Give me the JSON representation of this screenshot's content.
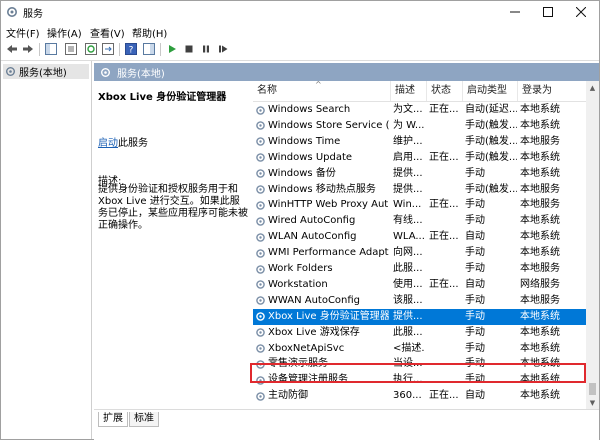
{
  "window": {
    "title": "服务"
  },
  "menu": [
    "文件(F)",
    "操作(A)",
    "查看(V)",
    "帮助(H)"
  ],
  "tree": {
    "root": "服务(本地)"
  },
  "panel": {
    "header": "服务(本地)"
  },
  "description": {
    "service_name": "Xbox Live 身份验证管理器",
    "start_link": "启动",
    "start_suffix": "此服务",
    "label": "描述:",
    "text": "提供身份验证和授权服务用于和 Xbox Live 进行交互。如果此服务已停止，某些应用程序可能未被正确操作。"
  },
  "columns": {
    "name": "名称",
    "desc": "描述",
    "status": "状态",
    "startup": "启动类型",
    "logon": "登录为"
  },
  "services": [
    {
      "name": "Windows Search",
      "desc": "为文...",
      "status": "正在...",
      "startup": "自动(延迟...",
      "logon": "本地系统"
    },
    {
      "name": "Windows Store Service (...",
      "desc": "为 W...",
      "status": "",
      "startup": "手动(触发...",
      "logon": "本地系统"
    },
    {
      "name": "Windows Time",
      "desc": "维护...",
      "status": "",
      "startup": "手动(触发...",
      "logon": "本地服务"
    },
    {
      "name": "Windows Update",
      "desc": "启用...",
      "status": "正在...",
      "startup": "手动(触发...",
      "logon": "本地系统"
    },
    {
      "name": "Windows 备份",
      "desc": "提供...",
      "status": "",
      "startup": "手动",
      "logon": "本地系统"
    },
    {
      "name": "Windows 移动热点服务",
      "desc": "提供...",
      "status": "",
      "startup": "手动(触发...",
      "logon": "本地服务"
    },
    {
      "name": "WinHTTP Web Proxy Aut...",
      "desc": "Win...",
      "status": "正在...",
      "startup": "手动",
      "logon": "本地服务"
    },
    {
      "name": "Wired AutoConfig",
      "desc": "有线...",
      "status": "",
      "startup": "手动",
      "logon": "本地系统"
    },
    {
      "name": "WLAN AutoConfig",
      "desc": "WLA...",
      "status": "正在...",
      "startup": "自动",
      "logon": "本地系统"
    },
    {
      "name": "WMI Performance Adapt...",
      "desc": "向网...",
      "status": "",
      "startup": "手动",
      "logon": "本地系统"
    },
    {
      "name": "Work Folders",
      "desc": "此服...",
      "status": "",
      "startup": "手动",
      "logon": "本地服务"
    },
    {
      "name": "Workstation",
      "desc": "使用...",
      "status": "正在...",
      "startup": "自动",
      "logon": "网络服务"
    },
    {
      "name": "WWAN AutoConfig",
      "desc": "该服...",
      "status": "",
      "startup": "手动",
      "logon": "本地服务"
    },
    {
      "name": "Xbox Live 身份验证管理器",
      "desc": "提供...",
      "status": "",
      "startup": "手动",
      "logon": "本地系统",
      "selected": true
    },
    {
      "name": "Xbox Live 游戏保存",
      "desc": "此服...",
      "status": "",
      "startup": "手动",
      "logon": "本地系统"
    },
    {
      "name": "XboxNetApiSvc",
      "desc": "<描述...",
      "status": "",
      "startup": "手动",
      "logon": "本地系统"
    },
    {
      "name": "零售演示服务",
      "desc": "当设...",
      "status": "",
      "startup": "手动",
      "logon": "本地系统"
    },
    {
      "name": "设备管理注册服务",
      "desc": "执行...",
      "status": "",
      "startup": "手动",
      "logon": "本地系统"
    },
    {
      "name": "主动防御",
      "desc": "360...",
      "status": "正在...",
      "startup": "自动",
      "logon": "本地系统"
    }
  ],
  "tabs": [
    "扩展",
    "标准"
  ],
  "colors": {
    "selection": "#0078d7",
    "header_band": "#8ea5c2",
    "highlight_box": "#e0292e"
  }
}
